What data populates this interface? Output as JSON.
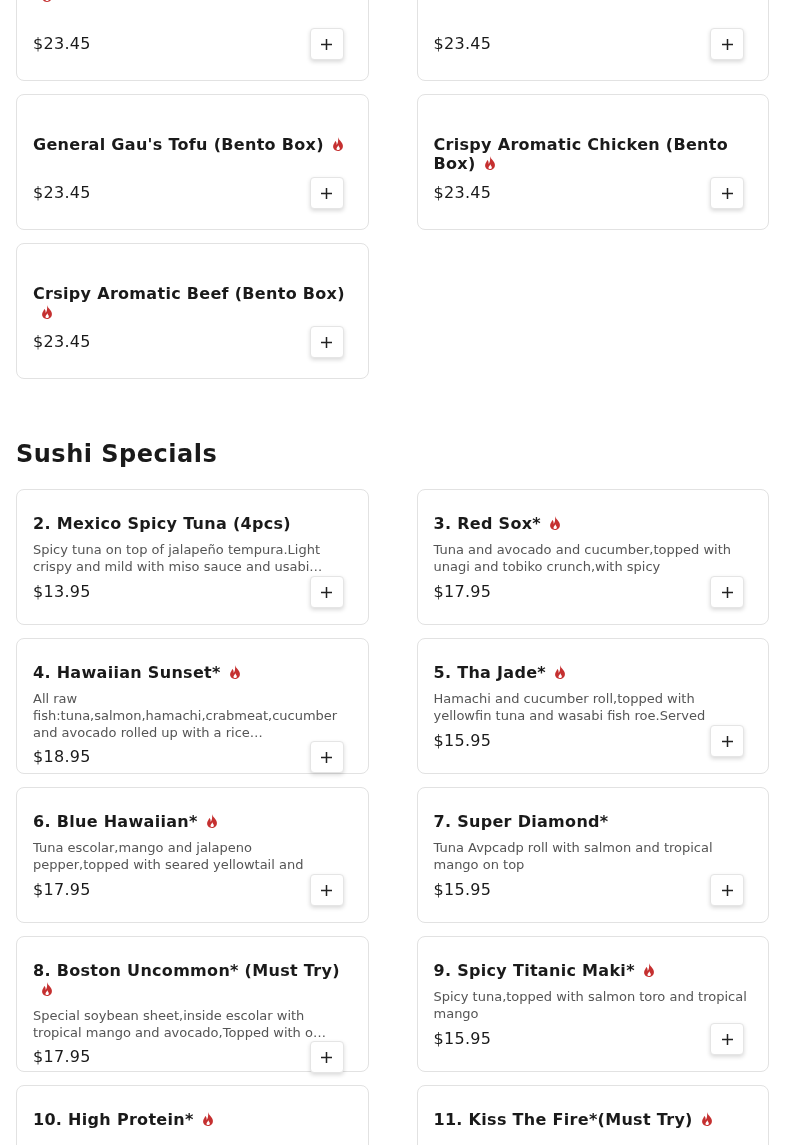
{
  "sections": [
    {
      "items": [
        {
          "price": "$23.45",
          "spicy": true
        },
        {
          "price": "$23.45",
          "spicy": false
        },
        {
          "name": "General Gau's Tofu (Bento Box)",
          "price": "$23.45",
          "spicy": true
        },
        {
          "name": "Crispy Aromatic Chicken (Bento Box)",
          "price": "$23.45",
          "spicy": true
        },
        {
          "name": "Crsipy Aromatic Beef (Bento Box)",
          "price": "$23.45",
          "spicy": true
        }
      ]
    },
    {
      "title": "Sushi Specials",
      "items": [
        {
          "name": "2. Mexico Spicy Tuna (4pcs)",
          "description": "Spicy tuna on top of jalapeño tempura.Light crispy and mild with miso sauce and usabi…",
          "price": "$13.95",
          "spicy": false
        },
        {
          "name": "3. Red Sox*",
          "description": "Tuna and avocado and cucumber,topped with unagi and tobiko crunch,with spicy",
          "price": "$17.95",
          "spicy": true
        },
        {
          "name": "4. Hawaiian Sunset*",
          "description": "All raw fish:tuna,salmon,hamachi,crabmeat,cucumber and avocado rolled up with a rice…",
          "price": "$18.95",
          "spicy": true
        },
        {
          "name": "5. Tha Jade*",
          "description": "Hamachi and cucumber roll,topped with yellowfin tuna and wasabi fish roe.Served",
          "price": "$15.95",
          "spicy": true
        },
        {
          "name": "6. Blue Hawaiian*",
          "description": "Tuna escolar,mango and jalapeno pepper,topped with seared yellowtail and",
          "price": "$17.95",
          "spicy": true
        },
        {
          "name": "7. Super Diamond*",
          "description": "Tuna Avpcadp roll with salmon and tropical mango on top",
          "price": "$15.95",
          "spicy": false
        },
        {
          "name": "8. Boston Uncommon* (Must Try)",
          "description": "Special soybean sheet,inside escolar with tropical mango and avocado,Topped with o…",
          "price": "$17.95",
          "spicy": true
        },
        {
          "name": "9. Spicy Titanic Maki*",
          "description": "Spicy tuna,topped with salmon toro and tropical mango",
          "price": "$15.95",
          "spicy": true
        },
        {
          "name": "10. High Protein*",
          "spicy": true
        },
        {
          "name": "11. Kiss The Fire*(Must Try)",
          "spicy": true
        }
      ]
    }
  ]
}
